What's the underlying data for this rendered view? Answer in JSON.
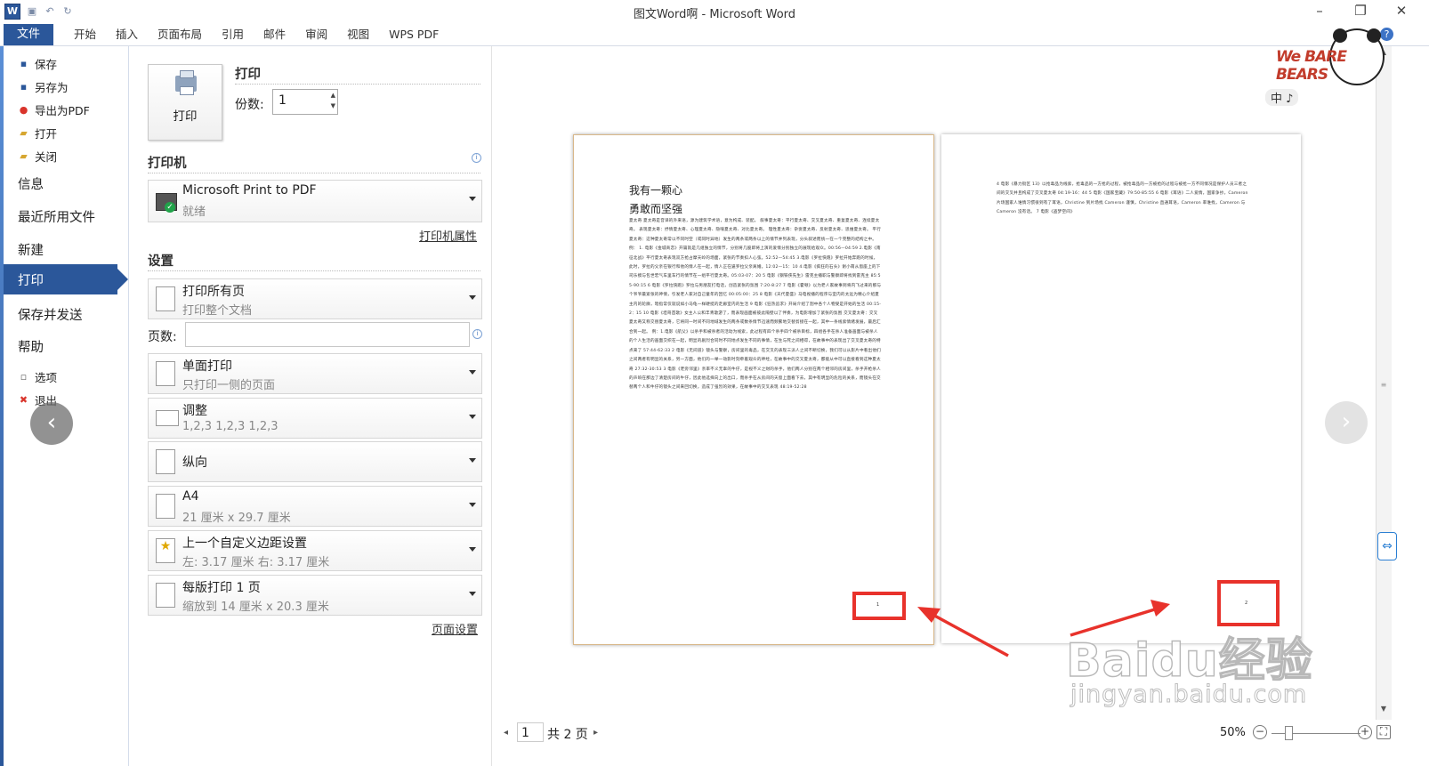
{
  "window": {
    "title": "图文Word啊 - Microsoft Word",
    "app_icon_letter": "W"
  },
  "ribbon": {
    "file_tab": "文件",
    "tabs": [
      "开始",
      "插入",
      "页面布局",
      "引用",
      "邮件",
      "审阅",
      "视图",
      "WPS PDF"
    ],
    "help_glyph": "?"
  },
  "backstage_nav": {
    "small_items": [
      {
        "label": "保存",
        "icon": "save-icon"
      },
      {
        "label": "另存为",
        "icon": "save-as-icon"
      },
      {
        "label": "导出为PDF",
        "icon": "pdf-export-icon"
      },
      {
        "label": "打开",
        "icon": "open-folder-icon"
      },
      {
        "label": "关闭",
        "icon": "close-folder-icon"
      }
    ],
    "big_items": [
      "信息",
      "最近所用文件",
      "新建",
      "打印",
      "保存并发送",
      "帮助"
    ],
    "selected": "打印",
    "bottom_items": [
      {
        "label": "选项",
        "icon": "options-icon"
      },
      {
        "label": "退出",
        "icon": "exit-icon"
      }
    ]
  },
  "print_panel": {
    "heading": "打印",
    "print_button": "打印",
    "copies_label": "份数:",
    "copies_value": "1",
    "printer_section": "打印机",
    "printer_name": "Microsoft Print to PDF",
    "printer_status": "就绪",
    "printer_props_link": "打印机属性",
    "settings_section": "设置",
    "settings": [
      {
        "l1": "打印所有页",
        "l2": "打印整个文档"
      },
      {
        "l1": "单面打印",
        "l2": "只打印一侧的页面"
      },
      {
        "l1": "调整",
        "l2": "1,2,3    1,2,3    1,2,3"
      },
      {
        "l1": "纵向",
        "l2": ""
      },
      {
        "l1": "A4",
        "l2": "21 厘米 x 29.7 厘米"
      },
      {
        "l1": "上一个自定义边距设置",
        "l2": "左:  3.17 厘米    右:  3.17 厘米"
      },
      {
        "l1": "每版打印 1 页",
        "l2": "缩放到 14 厘米 x 20.3 厘米"
      }
    ],
    "pages_label": "页数:",
    "pages_value": "",
    "page_setup_link": "页面设置"
  },
  "preview": {
    "page1": {
      "heading1": "我有一颗心",
      "heading2": "勇敢而坚强",
      "body": "夏太奇 夏太奇是音译的外来语，源为建筑学术语，意为构成、装配。 叙事夏太奇：平行夏太奇、交叉夏太奇、重复夏太奇、连续夏太奇。 表现夏太奇：抒情夏太奇、心理夏太奇、隐喻夏太奇、对比夏太奇。 理性夏太奇：杂耍夏太奇、反射夏太奇、思维夏太奇。 平行夏太奇：这种夏太奇常以不同时空（或同时异地）发生的两条或两条以上的情节并列表现，分头叙述而统一在一个完整的结构之中。 例： 1. 电影《金城商恋》开篇就是几组独立的情节，分别将几股即将上演的爱情分别独立的展现给观众。00:56—04:59 2.电影《南征北战》平行夏太奇表现双方抢占摩天岭的场面，紧张的节奏扣人心弦。52:52—54:45 3.电影《罗拉快跑》罗拉开始奔跑的时候，此时，罗拉的父亲在银行和他的情人在一起，情人正在逼罗拉父亲离婚。12:02—15：10 4.电影《疯狂的石头》谢小萌从窗座上的下司乐摸与包世宏气车里车行的情节在一组平行夏太奇。05:03-07：20 5 电影《钢铁侠先生》雷克主播职与警察即将找到雷克主 85:55-90:15 6 电影《罗拉快跑》罗拉与男朋友打电话，创造紧张的氛围 7:20-8:27 7 电影《霍顿》以为老人家故事到将内飞过来的那与个爷爷最紧张的神情，引发老人家对自己童年的回忆 00:05:00：25 8 电影《天代夏盛》马电视播的程序与室内的太远为精心介绍夏主内的轮廓，暗指常仅就说如小马龟一样硬挺的走廊室内的生活 9 电影《狂热追求》开局介绍了割中各个人物受是开始的生活 00:15-2：15 10 电影《坦哥首歌》女主人公和丰青歌游了，而表现画面被彼此隔壁以了伴奏，为电影增加了紧张的氛围 交叉夏太奇：交叉夏太奇又称交替夏太奇，它将同一时间不同地域发生的两条或数条情节迅速而频繁地交替剪接在一起，其中一条线索情绪发展，最后汇合到一起。 例：1.电影《航父》以杀手和被杀者的活动为线索，此过程有四个杀手四个被杀目标，四组各手在杀人准备画面与被杀人的个人生活的画面交织在一起，明显的剧烈合同时不同地点发生不同的事情，在生与死之间相得，在故事中的表现出了交叉夏太奇的特点来了 57:44-62:33 2 电影《无间道》镜头与警察，房间里的毒品，在交叉的表现三派人之间不断切换，我们可以从影片中看出他们之间两者有明显的关系，另一方面，他们的一举一动影时刻牵着观众的神经，在故事中的交叉夏太奇，都能从中可以直接看到这种夏太奇 27:32-30:53 3 电影《老旁邻里》亲率不义无辜的牛仔，是视不义之财的杀手，他们两人分别在两个相邻的房间里，杀手开枪杀人的声响在那边了清楚房间的牛仔，因此他选择向上的出口，而杀手在从房间的天窗上面看下去，其中有明显的危险的关系，而镜头在交替两个人和牛仔的镜头之间来回切换，造成了强烈的效果，在故事中的交叉表现 48:19-52:28",
      "page_number": "1"
    },
    "page2": {
      "body": "4 电影《暴力街区 13》以抢毒品为线索，抢毒品的一方抢的过程，被抢毒品的一方被抢的过程与被抢一方不同情况是保护人员三者之间的交叉并且构成了交叉夏太奇 04:19-16：44 5 电影《国家宝藏》79:50-85:55 6 电影《耳语》二人爱情，国家争抄，Cameron 片场国家人谁情习惯很到有了耳语，Christine 到片场找 Cameron 谨慎，Christine 直通耳语，Cameron 率谁找，Cameron 与 Cameron 沒有话。 7 电影《盗梦空间》",
      "page_number": "2"
    }
  },
  "status": {
    "current_page": "1",
    "total_pages": "共 2 页",
    "zoom": "50%"
  },
  "overlay": {
    "sticker_brand": "We BARE BEARS",
    "sticker_sub": "中 ♪",
    "watermark_main": "Baidu经验",
    "watermark_url": "jingyan.baidu.com"
  },
  "colors": {
    "accent": "#2b579a",
    "annotation_red": "#e8322b"
  }
}
